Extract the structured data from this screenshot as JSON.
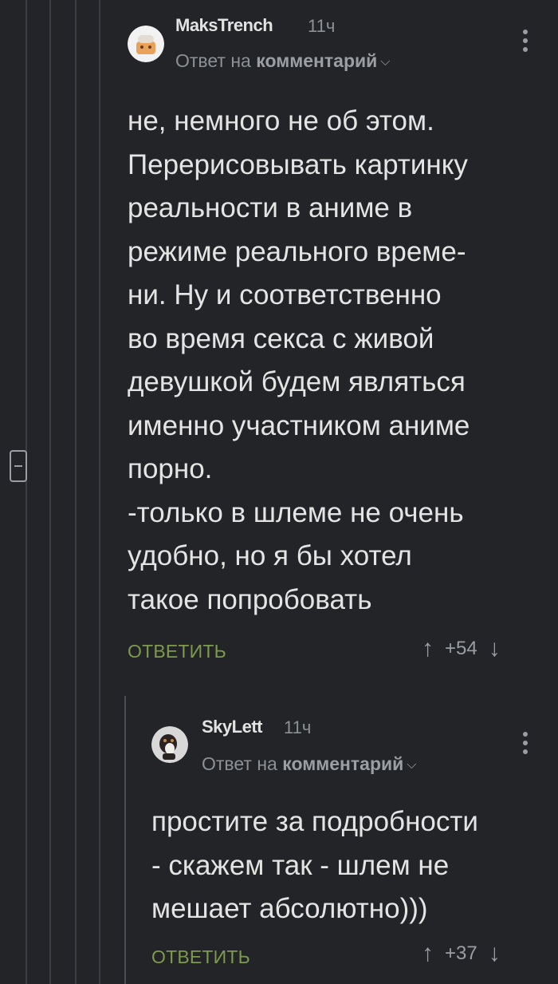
{
  "comment1": {
    "author": "MaksTrench",
    "time": "11ч",
    "reply_prefix": "Ответ на",
    "reply_target": "комментарий",
    "text": "не, немного не об этом.\nПерерисовывать картинку\nреальности в аниме в\nрежиме реального време-\nни. Ну и соответственно\nво время секса с живой\nдевушкой будем являться\nименно участником аниме\nпорно.\n-только в шлеме не очень\nудобно, но я бы хотел\nтакое попробовать",
    "reply_label": "ОТВЕТИТЬ",
    "rating": "+54"
  },
  "comment2": {
    "author": "SkyLett",
    "time": "11ч",
    "reply_prefix": "Ответ на",
    "reply_target": "комментарий",
    "text": "простите за подробности\n- скажем так - шлем не\nмешает абсолютно)))",
    "reply_label": "ОТВЕТИТЬ",
    "rating": "+37"
  },
  "icons": {
    "upvote": "arrow-up-icon",
    "downvote": "arrow-down-icon",
    "more": "vertical-dots-icon",
    "collapse": "collapse-thread-icon"
  },
  "colors": {
    "background": "#222427",
    "accent_reply": "#7d9a4d",
    "muted": "#8d9196"
  }
}
